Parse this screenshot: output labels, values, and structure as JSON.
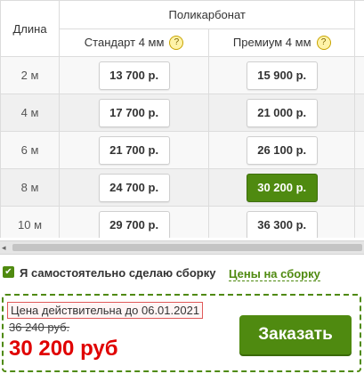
{
  "table": {
    "length_header": "Длина",
    "material_header": "Поликарбонат",
    "columns": [
      {
        "label": "Стандарт 4 мм",
        "help": "?"
      },
      {
        "label": "Премиум 4 мм",
        "help": "?"
      }
    ],
    "rows": [
      {
        "length": "2 м",
        "standard": "13 700 р.",
        "premium": "15 900 р."
      },
      {
        "length": "4 м",
        "standard": "17 700 р.",
        "premium": "21 000 р."
      },
      {
        "length": "6 м",
        "standard": "21 700 р.",
        "premium": "26 100 р."
      },
      {
        "length": "8 м",
        "standard": "24 700 р.",
        "premium": "30 200 р."
      },
      {
        "length": "10 м",
        "standard": "29 700 р.",
        "premium": "36 300 р."
      }
    ],
    "selected_cell": "8 м / Премиум 4 мм"
  },
  "scrollbar": {
    "left_arrow": "◂"
  },
  "options": {
    "self_assembly_checked": true,
    "checkmark": "✔",
    "self_assembly_label": "Я самостоятельно сделаю сборку",
    "assembly_prices_link": "Цены на сборку"
  },
  "order": {
    "validity": "Цена действительна до 06.01.2021",
    "old_price": "36 240 руб.",
    "new_price": "30 200 руб",
    "button_label": "Заказать"
  },
  "colors": {
    "accent": "#4f8a10",
    "price_red": "#e00000"
  }
}
